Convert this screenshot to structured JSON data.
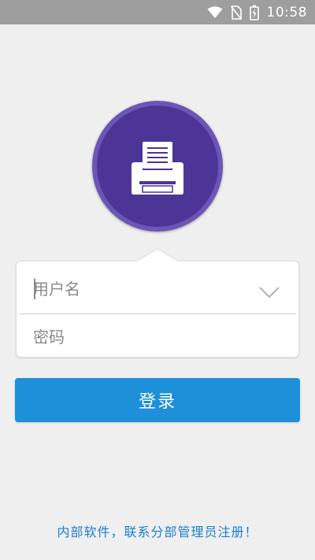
{
  "status_bar": {
    "time": "10:58",
    "icons": [
      "wifi-icon",
      "no-sim-icon",
      "battery-charging-icon"
    ]
  },
  "logo": {
    "icon": "printer-icon",
    "outer_color": "#6c55b6",
    "inner_color": "#4c3596"
  },
  "login_form": {
    "username_placeholder": "用户名",
    "username_value": "",
    "password_placeholder": "密码",
    "password_value": "",
    "dropdown_icon": "chevron-down-icon"
  },
  "login_button": {
    "label": "登录",
    "color": "#1e8fd9"
  },
  "footer": {
    "text": "内部软件，联系分部管理员注册！",
    "color": "#1a7fd0"
  }
}
